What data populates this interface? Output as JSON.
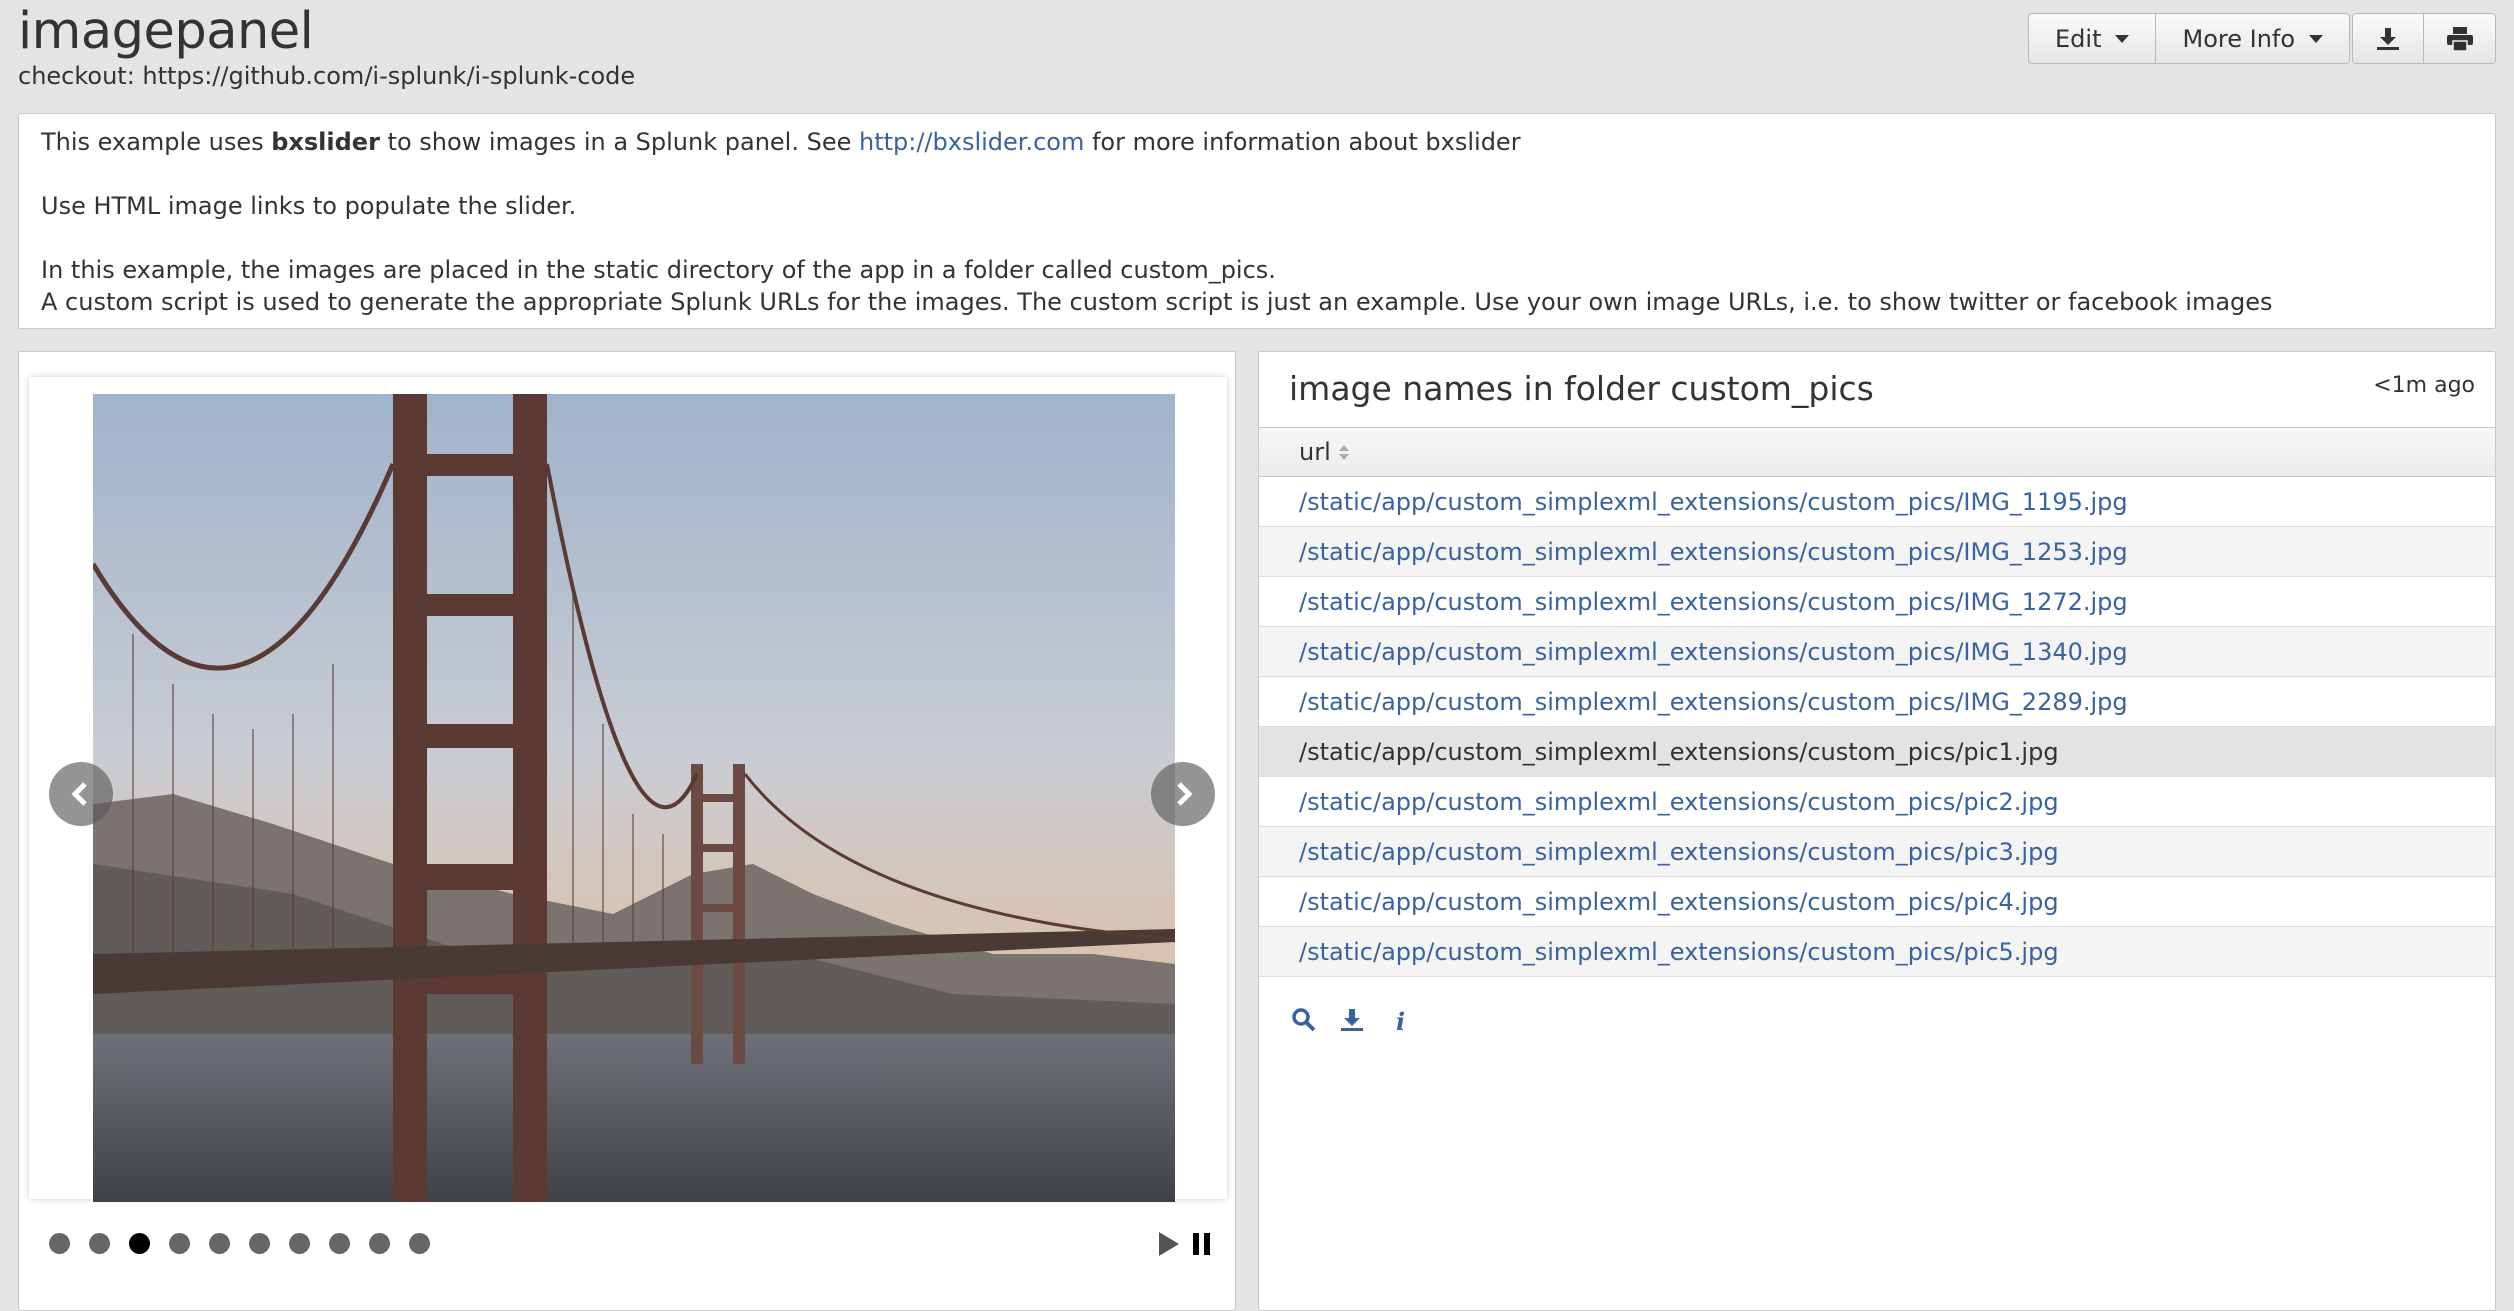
{
  "header": {
    "title": "imagepanel",
    "description": "checkout: https://github.com/i-splunk/i-splunk-code",
    "edit_label": "Edit",
    "more_info_label": "More Info",
    "export_icon": "download-icon",
    "print_icon": "print-icon"
  },
  "intro": {
    "line1_pre": "This example uses ",
    "line1_bold": "bxslider",
    "line1_mid": " to show images in a Splunk panel. See ",
    "line1_link": "http://bxslider.com",
    "line1_post": " for more information about bxslider",
    "line2": "Use HTML image links to populate the slider.",
    "line3": "In this example, the images are placed in the static directory of the app in a folder called custom_pics.",
    "line4": "A custom script is used to generate the appropriate Splunk URLs for the images. The custom script is just an example. Use your own image URLs, i.e. to show twitter or facebook images"
  },
  "slider": {
    "dot_count": 10,
    "active_index": 2,
    "prev_icon": "chevron-left-icon",
    "next_icon": "chevron-right-icon"
  },
  "table_panel": {
    "title": "image names in folder custom_pics",
    "timestamp": "<1m ago",
    "column": "url",
    "rows": [
      "/static/app/custom_simplexml_extensions/custom_pics/IMG_1195.jpg",
      "/static/app/custom_simplexml_extensions/custom_pics/IMG_1253.jpg",
      "/static/app/custom_simplexml_extensions/custom_pics/IMG_1272.jpg",
      "/static/app/custom_simplexml_extensions/custom_pics/IMG_1340.jpg",
      "/static/app/custom_simplexml_extensions/custom_pics/IMG_2289.jpg",
      "/static/app/custom_simplexml_extensions/custom_pics/pic1.jpg",
      "/static/app/custom_simplexml_extensions/custom_pics/pic2.jpg",
      "/static/app/custom_simplexml_extensions/custom_pics/pic3.jpg",
      "/static/app/custom_simplexml_extensions/custom_pics/pic4.jpg",
      "/static/app/custom_simplexml_extensions/custom_pics/pic5.jpg"
    ],
    "hover_row": 5
  },
  "colors": {
    "link": "#3863a0",
    "background": "#e4e4e4"
  }
}
